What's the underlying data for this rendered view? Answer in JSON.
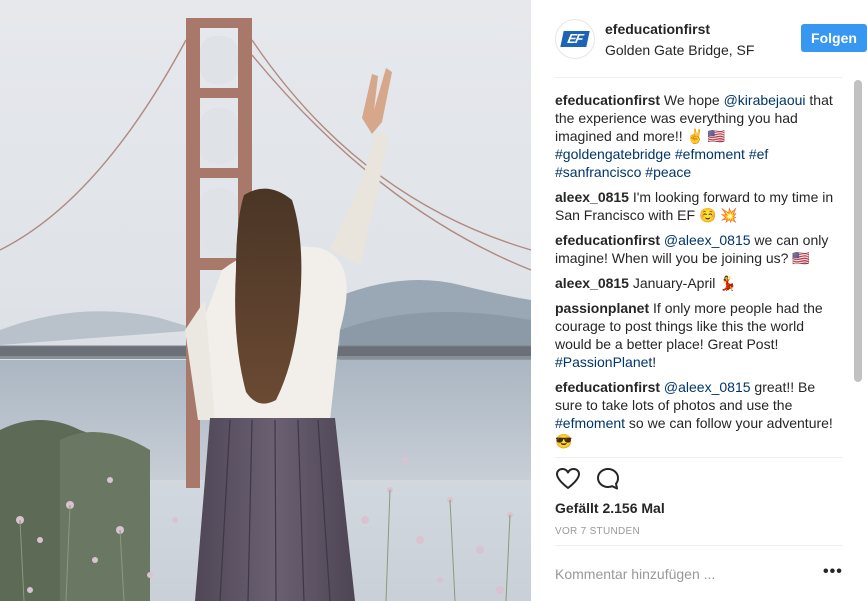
{
  "post": {
    "username": "efeducationfirst",
    "location": "Golden Gate Bridge, SF",
    "follow_label": "Folgen",
    "likes": "Gefällt 2.156 Mal",
    "time": "VOR 7 STUNDEN",
    "comment_placeholder": "Kommentar hinzufügen ...",
    "more_label": "•••",
    "avatar_text": "EF"
  },
  "comments": [
    {
      "user": "efeducationfirst",
      "parts": [
        {
          "t": " We hope "
        },
        {
          "t": "@kirabejaoui",
          "link": true
        },
        {
          "t": " that the experience was everything you had imagined and more!! ✌️ 🇺🇸 "
        },
        {
          "t": "#goldengatebridge",
          "link": true
        },
        {
          "t": " "
        },
        {
          "t": "#efmoment",
          "link": true
        },
        {
          "t": " "
        },
        {
          "t": "#ef",
          "link": true
        },
        {
          "t": " "
        },
        {
          "t": "#sanfrancisco",
          "link": true
        },
        {
          "t": " "
        },
        {
          "t": "#peace",
          "link": true
        }
      ]
    },
    {
      "user": "aleex_0815",
      "parts": [
        {
          "t": " I'm looking forward to my time in San Francisco with EF ☺️ 💥"
        }
      ]
    },
    {
      "user": "efeducationfirst",
      "parts": [
        {
          "t": " "
        },
        {
          "t": "@aleex_0815",
          "link": true
        },
        {
          "t": " we can only imagine! When will you be joining us? 🇺🇸"
        }
      ]
    },
    {
      "user": "aleex_0815",
      "parts": [
        {
          "t": " January-April 💃"
        }
      ]
    },
    {
      "user": "passionplanet",
      "parts": [
        {
          "t": " If only more people had the courage to post things like this the world would be a better place! Great Post! "
        },
        {
          "t": "#PassionPlanet",
          "link": true
        },
        {
          "t": "!"
        }
      ]
    },
    {
      "user": "efeducationfirst",
      "parts": [
        {
          "t": " "
        },
        {
          "t": "@aleex_0815",
          "link": true
        },
        {
          "t": " great!! Be sure to take lots of photos and use the "
        },
        {
          "t": "#efmoment",
          "link": true
        },
        {
          "t": " so we can follow your adventure! 😎"
        }
      ]
    }
  ],
  "icons": {
    "like": "heart-icon",
    "comment": "comment-icon",
    "more": "more-options-icon"
  },
  "colors": {
    "follow_button": "#3897f0",
    "link": "#003569",
    "text": "#262626",
    "muted": "#999999"
  }
}
